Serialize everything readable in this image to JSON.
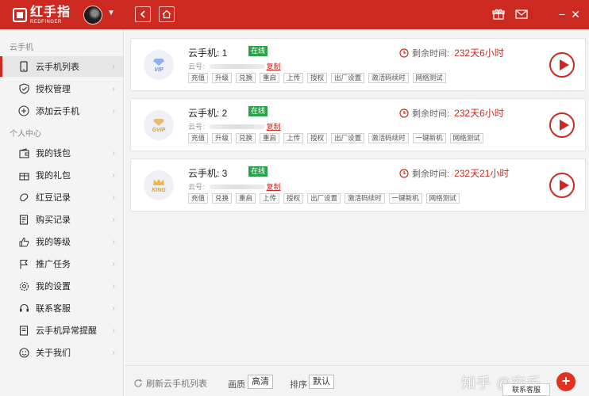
{
  "app": {
    "logo_cn": "红手指",
    "logo_en": "REDFINGER"
  },
  "topbar": {
    "back_icon": "chevron-left-icon",
    "home_icon": "home-icon",
    "gift_icon": "gift-icon",
    "mail_icon": "mail-icon",
    "minimize": "−",
    "close": "✕"
  },
  "sidebar": {
    "section_cloud": "云手机",
    "section_personal": "个人中心",
    "cloud_items": [
      {
        "label": "云手机列表",
        "icon": "phone-icon",
        "active": true
      },
      {
        "label": "授权管理",
        "icon": "shield-check-icon"
      },
      {
        "label": "添加云手机",
        "icon": "plus-circle-icon"
      }
    ],
    "personal_items": [
      {
        "label": "我的钱包",
        "icon": "wallet-icon"
      },
      {
        "label": "我的礼包",
        "icon": "gift-icon"
      },
      {
        "label": "红豆记录",
        "icon": "bean-icon"
      },
      {
        "label": "购买记录",
        "icon": "receipt-icon"
      },
      {
        "label": "我的等级",
        "icon": "thumb-icon"
      },
      {
        "label": "推广任务",
        "icon": "flag-icon"
      },
      {
        "label": "我的设置",
        "icon": "gear-icon"
      },
      {
        "label": "联系客服",
        "icon": "headset-icon"
      },
      {
        "label": "云手机异常提醒",
        "icon": "alert-icon"
      },
      {
        "label": "关于我们",
        "icon": "smile-icon"
      }
    ]
  },
  "phones": [
    {
      "name": "云手机: 1",
      "status": "在线",
      "id_label": "云号:",
      "copy": "复制",
      "level": "VIP",
      "level_color": "#6b8fe0",
      "remain_label": "剩余时间:",
      "remain_value": "232天6小时",
      "actions": [
        "充值",
        "升级",
        "兑换",
        "重启",
        "上传",
        "授权",
        "出厂设置",
        "激活码续时",
        "网络测试"
      ]
    },
    {
      "name": "云手机: 2",
      "status": "在线",
      "id_label": "云号:",
      "copy": "复制",
      "level": "GVIP",
      "level_color": "#d4a24a",
      "remain_label": "剩余时间:",
      "remain_value": "232天6小时",
      "actions": [
        "充值",
        "升级",
        "兑换",
        "重启",
        "上传",
        "授权",
        "出厂设置",
        "激活码续时",
        "一键新机",
        "网络测试"
      ]
    },
    {
      "name": "云手机: 3",
      "status": "在线",
      "id_label": "云号:",
      "copy": "复制",
      "level": "KING",
      "level_color": "#e0a030",
      "remain_label": "剩余时间:",
      "remain_value": "232天21小时",
      "actions": [
        "充值",
        "兑换",
        "重启",
        "上传",
        "授权",
        "出厂设置",
        "激活码续时",
        "一键新机",
        "网络测试"
      ]
    }
  ],
  "bottom": {
    "refresh": "刷新云手机列表",
    "quality_label": "画质",
    "quality_value": "高清",
    "sort_label": "排序",
    "sort_value": "默认",
    "watermark": "知乎 @安乐",
    "service": "联系客服"
  },
  "colors": {
    "brand": "#cc2a20",
    "online": "#2ba24a"
  }
}
